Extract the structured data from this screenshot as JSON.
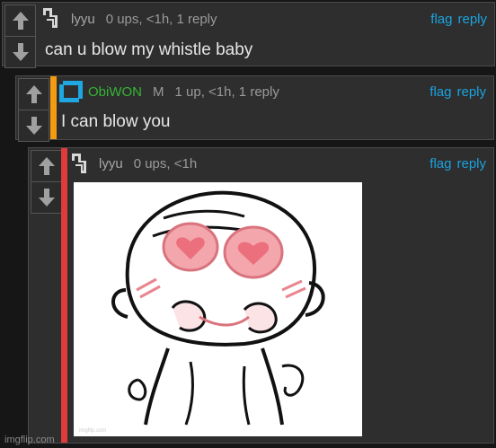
{
  "comments": [
    {
      "username": "lyyu",
      "mod_badge": "",
      "stats": "0 ups, <1h, 1 reply",
      "text": "can u blow my whistle baby",
      "flag_label": "flag",
      "reply_label": "reply",
      "username_color": "#a8a8a8"
    },
    {
      "username": "ObiWON",
      "mod_badge": "M",
      "stats": "1 up, <1h, 1 reply",
      "text": "I can blow you",
      "flag_label": "flag",
      "reply_label": "reply",
      "username_color": "#35b535",
      "bar_color": "#f39c12"
    },
    {
      "username": "lyyu",
      "mod_badge": "",
      "stats": "0 ups, <1h",
      "image_watermark": "imgflip.com",
      "flag_label": "flag",
      "reply_label": "reply",
      "username_color": "#a8a8a8",
      "bar_color": "#e03a3a"
    }
  ],
  "watermark": "imgflip.com",
  "colors": {
    "accent_link": "#1aa3e0",
    "background": "#161616",
    "card": "#2e2e2e"
  }
}
